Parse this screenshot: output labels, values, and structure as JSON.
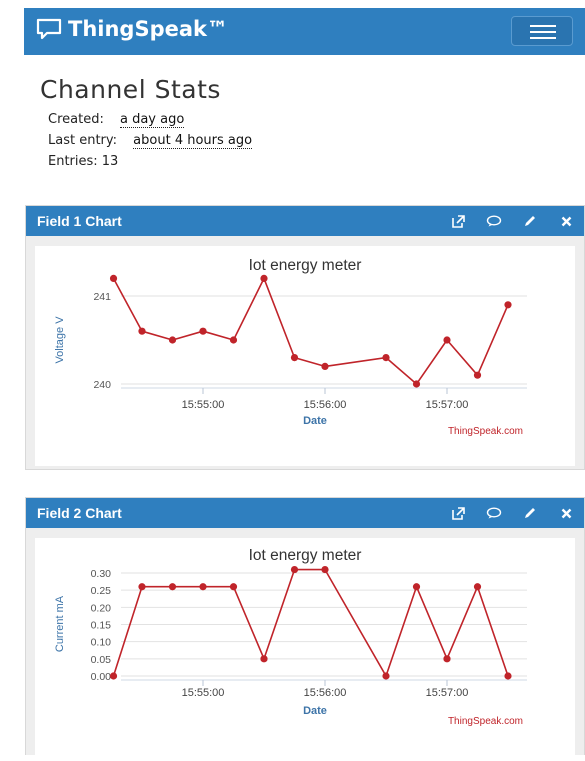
{
  "app": {
    "brand": "ThingSpeak™"
  },
  "stats": {
    "title": "Channel Stats",
    "created_label": "Created:",
    "created_value": "a day ago",
    "last_entry_label": "Last entry:",
    "last_entry_value": "about 4 hours ago",
    "entries_text": "Entries: 13"
  },
  "panels": [
    {
      "title": "Field 1 Chart"
    },
    {
      "title": "Field 2 Chart"
    }
  ],
  "colors": {
    "header": "#2f7fbf",
    "series": "#c0242a",
    "axis_label": "#3d74a8"
  },
  "chart_data": [
    {
      "type": "line",
      "title": "Iot energy meter",
      "xlabel": "Date",
      "ylabel": "Voltage V",
      "credit": "ThingSpeak.com",
      "x_ticks": [
        "15:55:00",
        "15:56:00",
        "15:57:00"
      ],
      "y_ticks": [
        "240",
        "241"
      ],
      "ylim": [
        240,
        241
      ],
      "series": [
        {
          "x": [
            "15:54:16",
            "15:54:30",
            "15:54:45",
            "15:55:00",
            "15:55:15",
            "15:55:30",
            "15:55:45",
            "15:56:00",
            "15:56:30",
            "15:56:45",
            "15:57:00",
            "15:57:15",
            "15:57:30"
          ],
          "values": [
            241.2,
            240.6,
            240.5,
            240.6,
            240.5,
            241.2,
            240.3,
            240.2,
            240.3,
            240.0,
            240.5,
            240.1,
            240.9
          ]
        }
      ]
    },
    {
      "type": "line",
      "title": "Iot energy meter",
      "xlabel": "Date",
      "ylabel": "Current mA",
      "credit": "ThingSpeak.com",
      "x_ticks": [
        "15:55:00",
        "15:56:00",
        "15:57:00"
      ],
      "y_ticks": [
        "0.00",
        "0.05",
        "0.10",
        "0.15",
        "0.20",
        "0.25",
        "0.30"
      ],
      "ylim": [
        0,
        0.3
      ],
      "series": [
        {
          "x": [
            "15:54:16",
            "15:54:30",
            "15:54:45",
            "15:55:00",
            "15:55:15",
            "15:55:30",
            "15:55:45",
            "15:56:00",
            "15:56:30",
            "15:56:45",
            "15:57:00",
            "15:57:15",
            "15:57:30"
          ],
          "values": [
            0.0,
            0.26,
            0.26,
            0.26,
            0.26,
            0.05,
            0.31,
            0.31,
            0.0,
            0.26,
            0.05,
            0.26,
            0.0
          ]
        }
      ]
    }
  ]
}
